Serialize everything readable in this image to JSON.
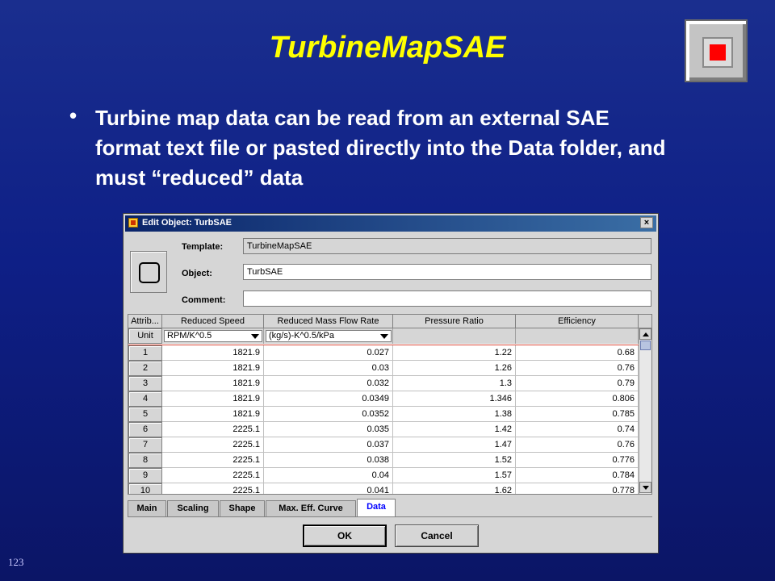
{
  "slide": {
    "title": "TurbineMapSAE",
    "bullet": "Turbine map data can be read from an external SAE format text file or pasted directly into the Data folder, and must “reduced” data",
    "page_number": "123",
    "title_color": "#ffff00"
  },
  "dialog": {
    "window_title": "Edit Object: TurbSAE",
    "close_symbol": "×",
    "labels": {
      "template": "Template:",
      "object": "Object:",
      "comment": "Comment:"
    },
    "template_value": "TurbineMapSAE",
    "object_value": "TurbSAE",
    "comment_value": "",
    "table": {
      "columns": [
        "Attrib...",
        "Reduced Speed",
        "Reduced Mass Flow Rate",
        "Pressure Ratio",
        "Efficiency"
      ],
      "unit_label": "Unit",
      "units": [
        "RPM/K^0.5",
        "(kg/s)-K^0.5/kPa",
        "",
        ""
      ],
      "rows": [
        [
          "1",
          "1821.9",
          "0.027",
          "1.22",
          "0.68"
        ],
        [
          "2",
          "1821.9",
          "0.03",
          "1.26",
          "0.76"
        ],
        [
          "3",
          "1821.9",
          "0.032",
          "1.3",
          "0.79"
        ],
        [
          "4",
          "1821.9",
          "0.0349",
          "1.346",
          "0.806"
        ],
        [
          "5",
          "1821.9",
          "0.0352",
          "1.38",
          "0.785"
        ],
        [
          "6",
          "2225.1",
          "0.035",
          "1.42",
          "0.74"
        ],
        [
          "7",
          "2225.1",
          "0.037",
          "1.47",
          "0.76"
        ],
        [
          "8",
          "2225.1",
          "0.038",
          "1.52",
          "0.776"
        ],
        [
          "9",
          "2225.1",
          "0.04",
          "1.57",
          "0.784"
        ],
        [
          "10",
          "2225.1",
          "0.041",
          "1.62",
          "0.778"
        ]
      ]
    },
    "tabs": [
      "Main",
      "Scaling",
      "Shape",
      "Max. Eff. Curve",
      "Data"
    ],
    "active_tab": "Data",
    "buttons": {
      "ok": "OK",
      "cancel": "Cancel"
    }
  }
}
